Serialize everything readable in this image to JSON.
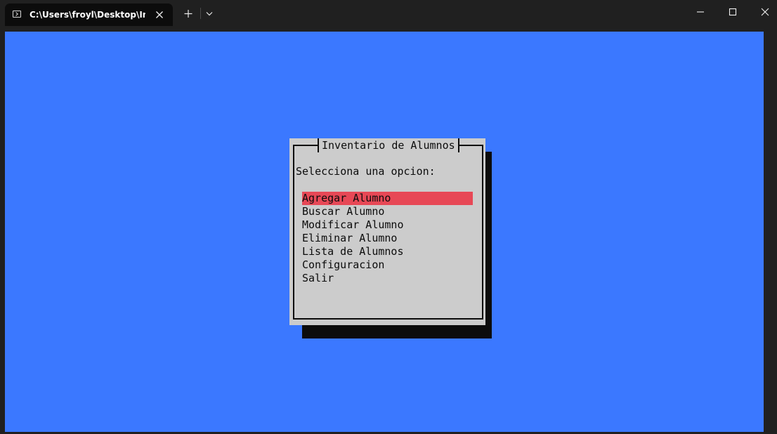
{
  "window": {
    "tab_title": "C:\\Users\\froyl\\Desktop\\Inven",
    "icons": {
      "tab": "terminal-icon",
      "close_tab": "close-icon",
      "new_tab": "plus-icon",
      "dropdown": "chevron-down-icon",
      "minimize": "minimize-icon",
      "maximize": "maximize-icon",
      "close_window": "close-icon"
    }
  },
  "colors": {
    "terminal_background": "#3b78ff",
    "dialog_background": "#cccccc",
    "selection": "#e74856",
    "shadow": "#0c0c0c"
  },
  "dialog": {
    "title": "Inventario de Alumnos",
    "prompt": "Selecciona una opcion:",
    "selected_index": 0,
    "options": [
      "Agregar Alumno",
      "Buscar Alumno",
      "Modificar Alumno",
      "Eliminar Alumno",
      "Lista de Alumnos",
      "Configuracion",
      "Salir"
    ]
  }
}
